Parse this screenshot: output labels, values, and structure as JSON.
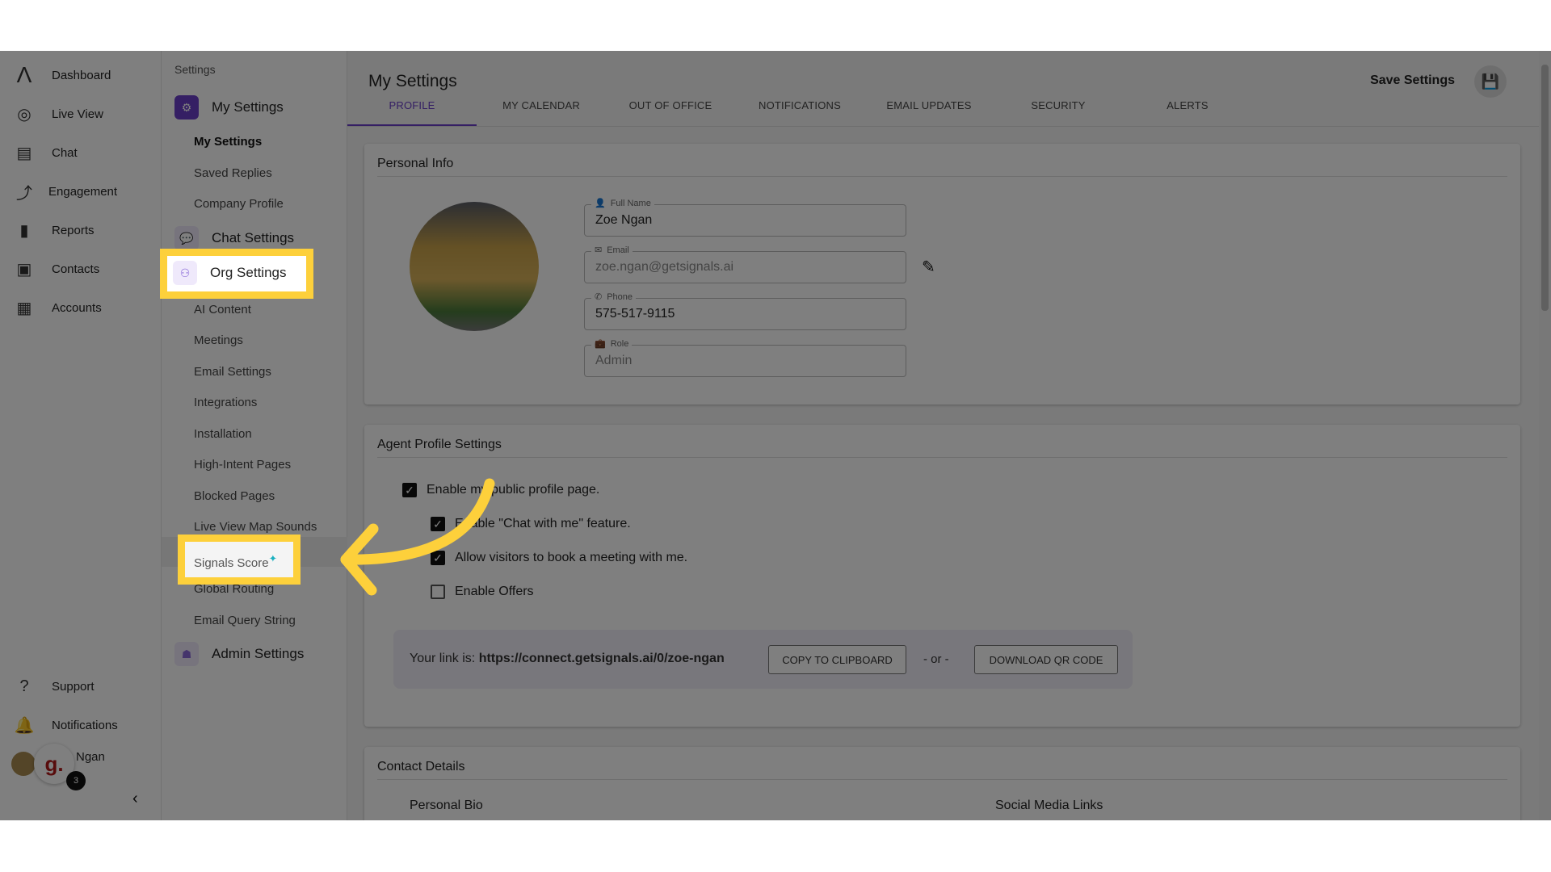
{
  "nav": {
    "items": [
      {
        "label": "Dashboard",
        "icon": "logo-icon"
      },
      {
        "label": "Live View",
        "icon": "globe-search-icon"
      },
      {
        "label": "Chat",
        "icon": "chat-icon"
      },
      {
        "label": "Engagement",
        "icon": "engagement-icon"
      },
      {
        "label": "Reports",
        "icon": "bar-chart-icon"
      },
      {
        "label": "Contacts",
        "icon": "contacts-icon"
      },
      {
        "label": "Accounts",
        "icon": "building-icon"
      }
    ],
    "bottom": [
      {
        "label": "Support",
        "icon": "help-icon"
      },
      {
        "label": "Notifications",
        "icon": "bell-icon"
      }
    ],
    "user": {
      "name": "Ngan",
      "badge": "3",
      "logo": "g."
    }
  },
  "settings_sidebar": {
    "title": "Settings",
    "my_settings": "My Settings",
    "my_items": [
      "My Settings",
      "Saved Replies",
      "Company Profile"
    ],
    "chat_settings": "Chat Settings",
    "org_settings": "Org Settings",
    "org_items": [
      "AI Content",
      "Meetings",
      "Email Settings",
      "Integrations",
      "Installation",
      "High-Intent Pages",
      "Blocked Pages",
      "Live View Map Sounds",
      "Signals Score",
      "Global Routing",
      "Email Query String"
    ],
    "admin_settings": "Admin Settings"
  },
  "header": {
    "title": "My Settings",
    "save_label": "Save Settings",
    "tabs": [
      "PROFILE",
      "MY CALENDAR",
      "OUT OF OFFICE",
      "NOTIFICATIONS",
      "EMAIL UPDATES",
      "SECURITY",
      "ALERTS"
    ],
    "active_tab": "PROFILE"
  },
  "personal_info": {
    "title": "Personal Info",
    "fields": [
      {
        "label": "Full Name",
        "value": "Zoe Ngan"
      },
      {
        "label": "Email",
        "value": "zoe.ngan@getsignals.ai"
      },
      {
        "label": "Phone",
        "value": "575-517-9115"
      },
      {
        "label": "Role",
        "value": "Admin"
      }
    ]
  },
  "agent_profile": {
    "title": "Agent Profile Settings",
    "options": [
      {
        "label": "Enable my public profile page.",
        "checked": true
      },
      {
        "label": "Enable \"Chat with me\" feature.",
        "checked": true
      },
      {
        "label": "Allow visitors to book a meeting with me.",
        "checked": true
      },
      {
        "label": "Enable Offers",
        "checked": false
      }
    ],
    "link_prefix": "Your link is:",
    "link": "https://connect.getsignals.ai/0/zoe-ngan",
    "copy_label": "COPY TO CLIPBOARD",
    "or_label": "- or -",
    "qr_label": "DOWNLOAD QR CODE"
  },
  "contact_details": {
    "title": "Contact Details",
    "bio_label": "Personal Bio",
    "social_label": "Social Media Links"
  },
  "colors": {
    "accent": "#6a3fc8",
    "highlight": "#fdd03b"
  }
}
